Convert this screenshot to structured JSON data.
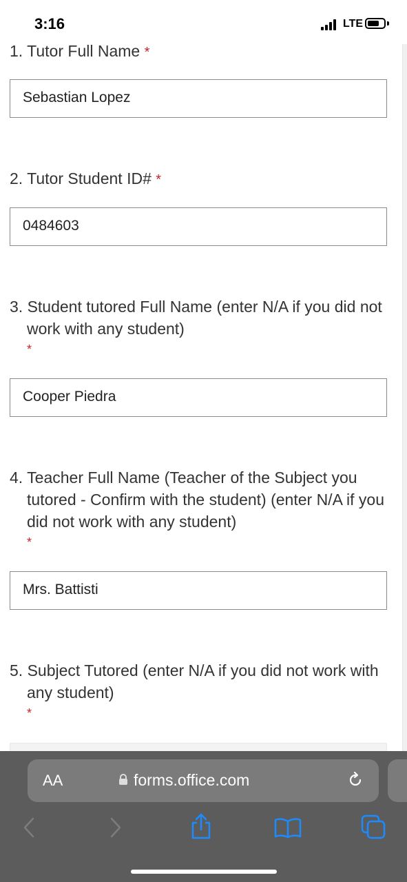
{
  "status_bar": {
    "time": "3:16",
    "network": "LTE"
  },
  "questions": [
    {
      "number": "1.",
      "title": "Tutor Full Name",
      "required_marker": "*",
      "answer": "Sebastian Lopez"
    },
    {
      "number": "2.",
      "title": "Tutor Student ID#",
      "required_marker": "*",
      "answer": "0484603"
    },
    {
      "number": "3.",
      "title": "Student tutored Full Name (enter N/A if you did not work with any student)",
      "required_marker": "*",
      "answer": "Cooper Piedra"
    },
    {
      "number": "4.",
      "title": "Teacher Full Name (Teacher of the Subject you tutored - Confirm with the student) (enter N/A if you did not work with any student)",
      "required_marker": "*",
      "answer": "Mrs. Battisti"
    },
    {
      "number": "5.",
      "title": "Subject Tutored (enter N/A if you did not work with any student)",
      "required_marker": "*",
      "answer": ""
    }
  ],
  "browser": {
    "text_size_label": "AA",
    "url": "forms.office.com",
    "icons": [
      "back-icon",
      "forward-icon",
      "share-icon",
      "bookmarks-icon",
      "tabs-icon",
      "reload-icon",
      "lock-icon"
    ],
    "icon_color": "#1a8cff"
  }
}
